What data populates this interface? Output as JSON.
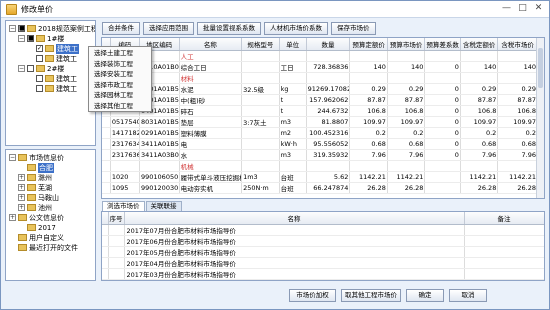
{
  "window": {
    "title": "修改单价",
    "minimize": "—",
    "maximize": "□",
    "close": "✕"
  },
  "project_tree": [
    {
      "label": "2018规范案例工程",
      "indent": 0,
      "checkbox": "■",
      "expander": "−",
      "selected": false
    },
    {
      "label": "1#楼",
      "indent": 1,
      "checkbox": "■",
      "expander": "−",
      "selected": false
    },
    {
      "label": "建筑工",
      "indent": 2,
      "checkbox": "✓",
      "expander": "",
      "selected": true
    },
    {
      "label": "建筑工",
      "indent": 2,
      "checkbox": "",
      "expander": "",
      "selected": false
    },
    {
      "label": "2#楼",
      "indent": 1,
      "checkbox": "",
      "expander": "−",
      "selected": false
    },
    {
      "label": "建筑工",
      "indent": 2,
      "checkbox": "",
      "expander": "",
      "selected": false
    },
    {
      "label": "建筑工",
      "indent": 2,
      "checkbox": "",
      "expander": "",
      "selected": false
    }
  ],
  "context_menu": [
    "选择土建工程",
    "选择装饰工程",
    "选择安装工程",
    "选择市政工程",
    "选择园林工程",
    "选择其他工程"
  ],
  "price_tree": [
    {
      "label": "市场信息价",
      "indent": 0,
      "expander": "−",
      "selected": false
    },
    {
      "label": "合肥",
      "indent": 1,
      "expander": "",
      "selected": true
    },
    {
      "label": "滁州",
      "indent": 1,
      "expander": "+",
      "selected": false
    },
    {
      "label": "芜湖",
      "indent": 1,
      "expander": "+",
      "selected": false
    },
    {
      "label": "马鞍山",
      "indent": 1,
      "expander": "+",
      "selected": false
    },
    {
      "label": "池州",
      "indent": 1,
      "expander": "+",
      "selected": false
    },
    {
      "label": "公文信息价",
      "indent": 0,
      "expander": "+",
      "selected": false
    },
    {
      "label": "2017",
      "indent": 1,
      "expander": "",
      "selected": false
    },
    {
      "label": "用户自定义",
      "indent": 0,
      "expander": "",
      "selected": false
    },
    {
      "label": "最近打开的文件",
      "indent": 0,
      "expander": "",
      "selected": false
    }
  ],
  "toolbar": [
    "合并条件",
    "选择应用范围",
    "批量设置视系系数",
    "人材机市场价系数",
    "保存市场价"
  ],
  "columns": [
    "编码",
    "地区编码",
    "名称",
    "规格型号",
    "单位",
    "数量",
    "预算定额价",
    "预算市场价",
    "预算差系数",
    "含税定额价",
    "含税市场价"
  ],
  "rows": [
    {
      "cat": true,
      "c": [
        "",
        "",
        "人工",
        "",
        "",
        "",
        "",
        "",
        "",
        "",
        ""
      ]
    },
    {
      "cat": false,
      "c": [
        "",
        "1010A01B01BC",
        "综合工日",
        "",
        "工日",
        "728.36836",
        "140",
        "140",
        "0",
        "140",
        "140"
      ]
    },
    {
      "cat": true,
      "c": [
        "",
        "",
        "材料",
        "",
        "",
        "",
        "",
        "",
        "",
        "",
        ""
      ]
    },
    {
      "cat": false,
      "c": [
        "",
        "0401A01B51B",
        "水泥",
        "32.5级",
        "kg",
        "91269.17082",
        "0.29",
        "0.29",
        "0",
        "0.29",
        "0.29"
      ]
    },
    {
      "cat": false,
      "c": [
        "",
        "0401A01B51BC",
        "中(粗)砂",
        "",
        "t",
        "157.962062",
        "87.87",
        "87.87",
        "0",
        "87.87",
        "87.87"
      ]
    },
    {
      "cat": false,
      "c": [
        "",
        "0401A01B51BC",
        "碎石",
        "",
        "t",
        "244.6732",
        "106.8",
        "106.8",
        "0",
        "106.8",
        "106.8"
      ]
    },
    {
      "cat": false,
      "c": [
        "0517540",
        "8031A01B51BV",
        "垫层",
        "3:7灰土",
        "m3",
        "81.8807",
        "109.97",
        "109.97",
        "0",
        "109.97",
        "109.97"
      ]
    },
    {
      "cat": false,
      "c": [
        "1417182",
        "0291A01B51B",
        "塑料薄膜",
        "",
        "m2",
        "100.452316",
        "0.2",
        "0.2",
        "0",
        "0.2",
        "0.2"
      ]
    },
    {
      "cat": false,
      "c": [
        "2317634",
        "3411A01B51BV",
        "电",
        "",
        "kW·h",
        "95.556052",
        "0.68",
        "0.68",
        "0",
        "0.68",
        "0.68"
      ]
    },
    {
      "cat": false,
      "c": [
        "2317636",
        "3411A03B01BV",
        "水",
        "",
        "m3",
        "319.35932",
        "7.96",
        "7.96",
        "0",
        "7.96",
        "7.96"
      ]
    },
    {
      "cat": true,
      "c": [
        "",
        "",
        "机械",
        "",
        "",
        "",
        "",
        "",
        "",
        "",
        ""
      ]
    },
    {
      "cat": false,
      "c": [
        "1020",
        "990106050",
        "履带式单斗液压挖掘机",
        "1m3",
        "台班",
        "5.62",
        "1142.21",
        "1142.21",
        "",
        "1142.21",
        "1142.21"
      ]
    },
    {
      "cat": false,
      "c": [
        "1095",
        "990120030",
        "电动夯实机",
        "250N·m",
        "台班",
        "66.247874",
        "26.28",
        "26.28",
        "",
        "26.28",
        "26.28"
      ]
    }
  ],
  "tabs": [
    "浏选市场价",
    "关联联接"
  ],
  "price_columns": [
    "序号",
    "名称",
    "备注"
  ],
  "price_list": [
    "2017年07月份合肥市材料市场指导价",
    "2017年06月份合肥市材料市场指导价",
    "2017年05月份合肥市材料市场指导价",
    "2017年04月份合肥市材料市场指导价",
    "2017年03月份合肥市材料市场指导价",
    "2017年02月份合肥市材料市场指导价"
  ],
  "footer": {
    "load_btn": "市场价加权",
    "cancel_load_btn": "取其他工程市场价",
    "ok_btn": "确定",
    "cancel_btn": "取消"
  }
}
